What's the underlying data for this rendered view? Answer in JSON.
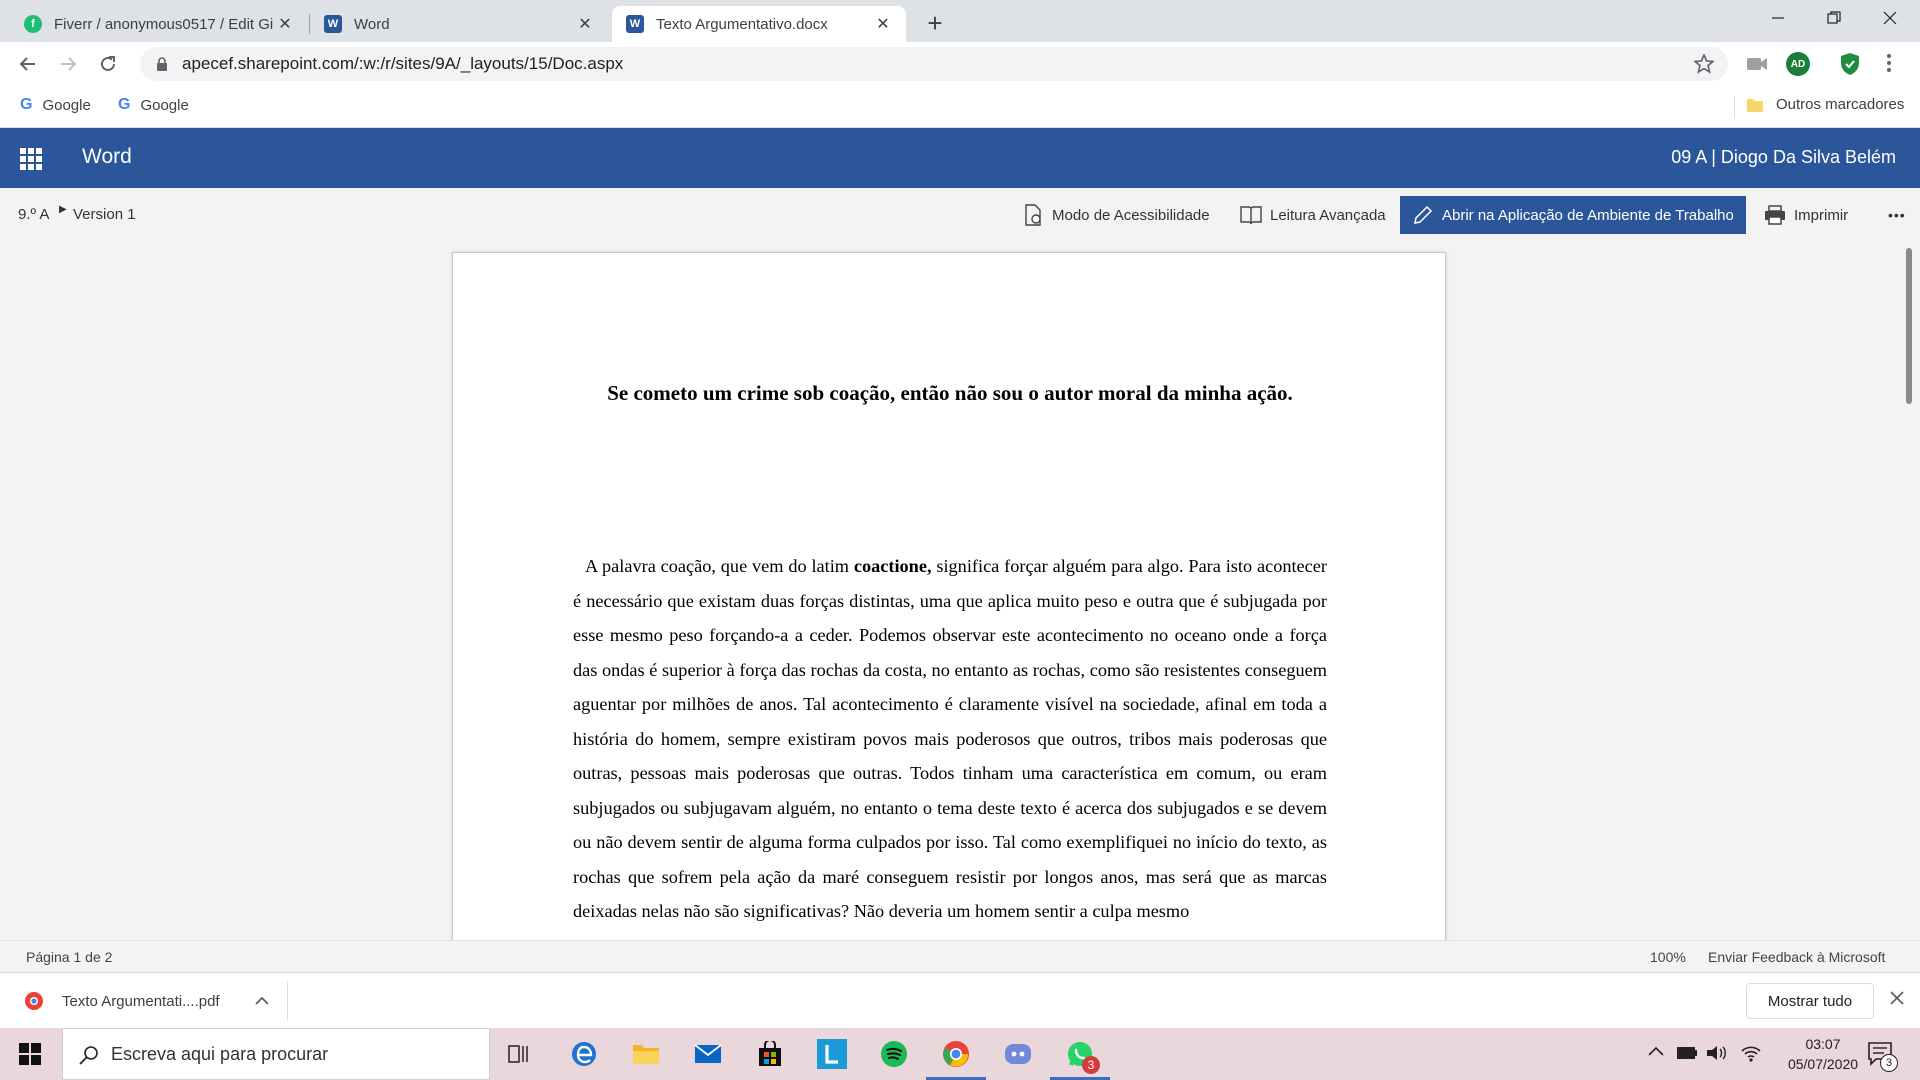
{
  "browser": {
    "tabs": [
      {
        "title": "Fiverr / anonymous0517 / Edit Gi",
        "favicon": "fiverr-icon",
        "active": false
      },
      {
        "title": "Word",
        "favicon": "word-icon",
        "active": false
      },
      {
        "title": "Texto Argumentativo.docx",
        "favicon": "word-icon",
        "active": true
      }
    ],
    "new_tab_label": "+",
    "address": "apecef.sharepoint.com/:w:/r/sites/9A/_layouts/15/Doc.aspx",
    "profile_initials": "AD",
    "bookmarks": [
      "Google",
      "Google"
    ],
    "other_bookmarks": "Outros marcadores"
  },
  "word": {
    "app_name": "Word",
    "user": "09 A | Diogo Da Silva Belém",
    "breadcrumb": [
      "9.º A",
      "Version 1"
    ],
    "commands": {
      "accessibility": "Modo de Acessibilidade",
      "reading": "Leitura Avançada",
      "open_desktop": "Abrir na Aplicação de Ambiente de Trabalho",
      "print": "Imprimir",
      "more": "•••"
    }
  },
  "document": {
    "title": "Se cometo um crime sob coação, então não sou o autor moral da minha ação.",
    "body_before": "A palavra coação, que vem do latim ",
    "body_bold": "coactione,",
    "body_after": " significa forçar alguém para algo. Para isto acontecer é necessário que existam duas forças distintas, uma que aplica muito peso e outra que é subjugada por esse mesmo peso forçando-a a ceder. Podemos observar este acontecimento no oceano onde a força das ondas é superior à força das rochas da costa, no entanto as rochas, como são resistentes conseguem aguentar por milhões de anos. Tal acontecimento é claramente visível na sociedade, afinal em toda a história do homem, sempre existiram povos mais poderosos que outros, tribos mais poderosas que outras, pessoas mais poderosas que outras. Todos tinham uma característica em comum, ou eram subjugados ou subjugavam alguém, no entanto o tema deste texto é acerca dos subjugados e se devem ou não devem sentir de alguma forma culpados por isso. Tal como exemplifiquei no início do texto, as rochas que sofrem pela ação da maré conseguem resistir por longos anos, mas será que as marcas deixadas nelas não são significativas? Não deveria um homem sentir a culpa mesmo"
  },
  "status": {
    "page": "Página 1 de 2",
    "zoom": "100%",
    "feedback": "Enviar Feedback à Microsoft"
  },
  "downloads": {
    "file": "Texto Argumentati....pdf",
    "show_all": "Mostrar tudo"
  },
  "taskbar": {
    "search_placeholder": "Escreva aqui para procurar",
    "time": "03:07",
    "date": "05/07/2020",
    "notifications": "3",
    "whatsapp_badge": "3"
  }
}
